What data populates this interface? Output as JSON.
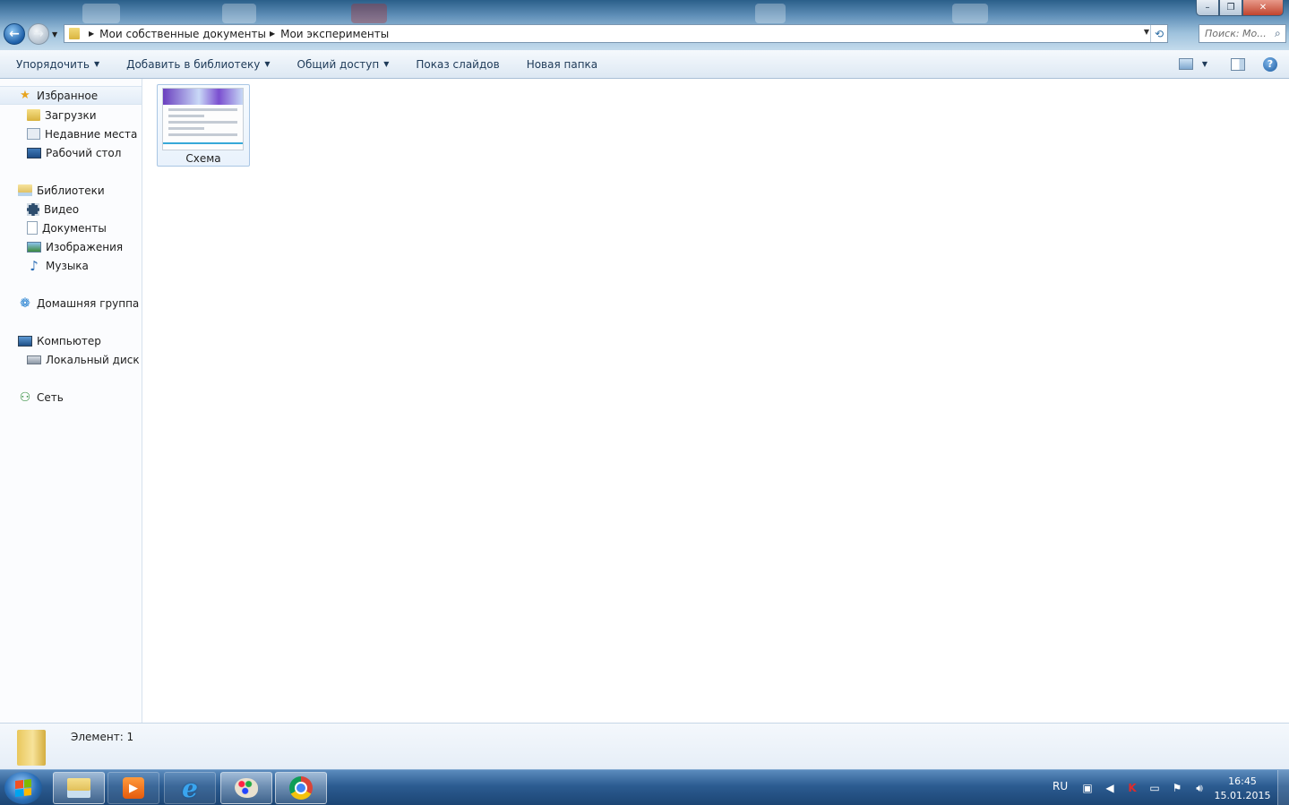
{
  "window": {
    "buttons": {
      "minimize": "–",
      "maximize": "❐",
      "close": "✕"
    }
  },
  "address": {
    "crumbs": [
      "Мои собственные документы",
      "Мои эксперименты"
    ]
  },
  "search": {
    "placeholder": "Поиск: Мо..."
  },
  "toolbar": {
    "items": [
      {
        "label": "Упорядочить",
        "dropdown": true
      },
      {
        "label": "Добавить в библиотеку",
        "dropdown": true
      },
      {
        "label": "Общий доступ",
        "dropdown": true
      },
      {
        "label": "Показ слайдов",
        "dropdown": false
      },
      {
        "label": "Новая папка",
        "dropdown": false
      }
    ],
    "help": "?"
  },
  "nav": {
    "favorites": {
      "label": "Избранное",
      "items": [
        "Загрузки",
        "Недавние места",
        "Рабочий стол"
      ]
    },
    "libraries": {
      "label": "Библиотеки",
      "items": [
        "Видео",
        "Документы",
        "Изображения",
        "Музыка"
      ]
    },
    "homegroup": {
      "label": "Домашняя группа"
    },
    "computer": {
      "label": "Компьютер",
      "items": [
        "Локальный диск (C"
      ]
    },
    "network": {
      "label": "Сеть"
    }
  },
  "files": [
    {
      "name": "Схема"
    }
  ],
  "details": {
    "count_text": "Элемент: 1"
  },
  "taskbar": {
    "language": "RU",
    "time": "16:45",
    "date": "15.01.2015"
  },
  "colors": {
    "accent": "#2c5c91",
    "selection": "#e2ecf7",
    "command_text": "#1e3a58"
  }
}
